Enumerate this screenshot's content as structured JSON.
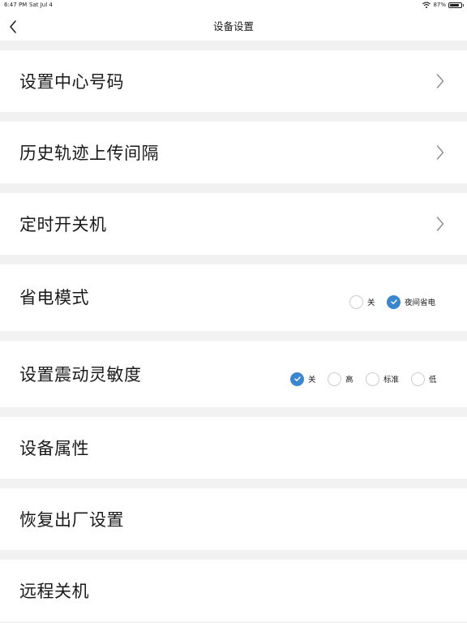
{
  "status_bar": {
    "time": "6:47 PM",
    "date": "Sat Jul 4",
    "battery": "87%"
  },
  "nav": {
    "title": "设备设置"
  },
  "rows": [
    {
      "label": "设置中心号码"
    },
    {
      "label": "历史轨迹上传间隔"
    },
    {
      "label": "定时开关机"
    },
    {
      "label": "省电模式",
      "options": [
        {
          "label": "关",
          "checked": false
        },
        {
          "label": "夜间省电",
          "checked": true
        }
      ]
    },
    {
      "label": "设置震动灵敏度",
      "options": [
        {
          "label": "关",
          "checked": true
        },
        {
          "label": "高",
          "checked": false
        },
        {
          "label": "标准",
          "checked": false
        },
        {
          "label": "低",
          "checked": false
        }
      ]
    },
    {
      "label": "设备属性"
    },
    {
      "label": "恢复出厂设置"
    },
    {
      "label": "远程关机"
    }
  ],
  "colors": {
    "accent": "#3a87cf",
    "background": "#f2f2f2",
    "row": "#ffffff"
  }
}
